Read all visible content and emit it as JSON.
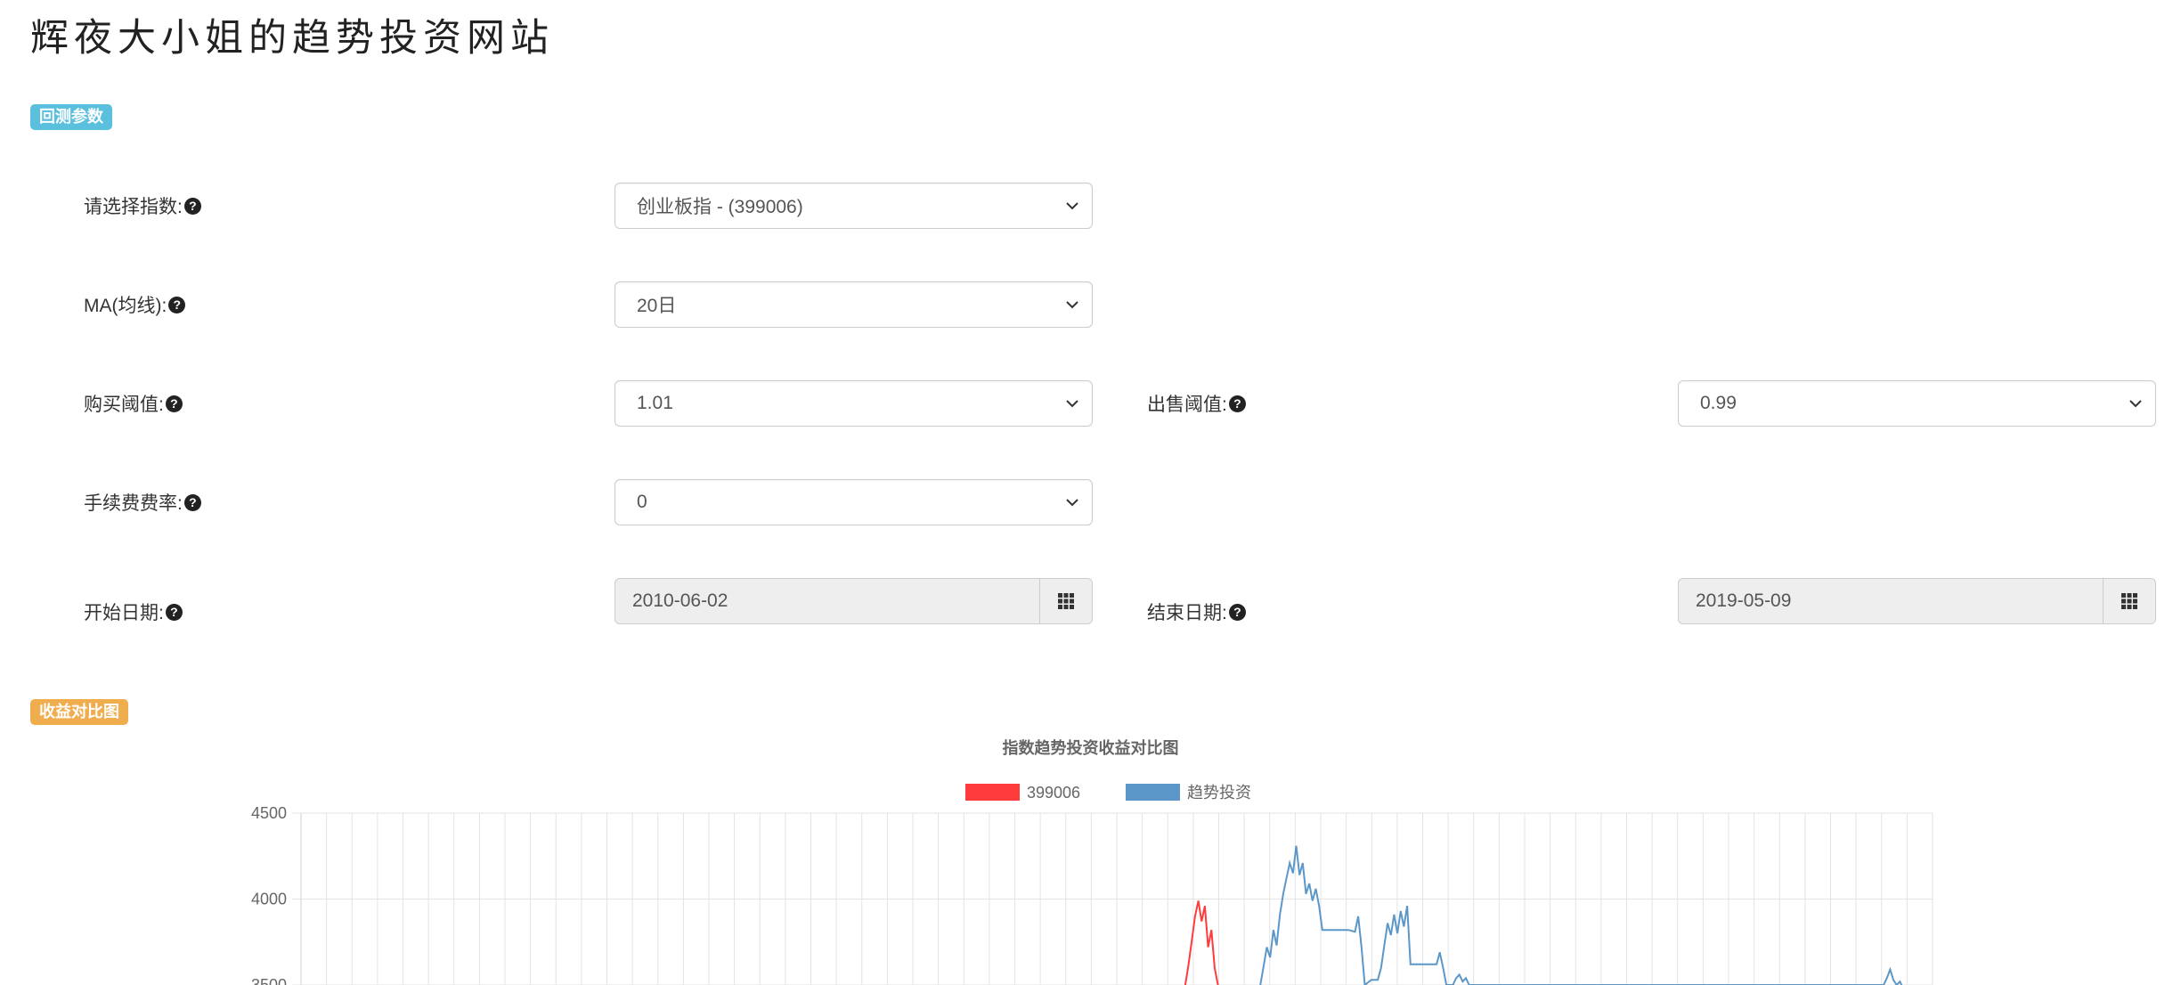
{
  "title": "辉夜大小姐的趋势投资网站",
  "params_badge": "回测参数",
  "compare_badge": "收益对比图",
  "form": {
    "index_label": "请选择指数:",
    "index_value": "创业板指 - (399006)",
    "ma_label": "MA(均线):",
    "ma_value": "20日",
    "buy_label": "购买阈值:",
    "buy_value": "1.01",
    "sell_label": "出售阈值:",
    "sell_value": "0.99",
    "fee_label": "手续费费率:",
    "fee_value": "0",
    "start_label": "开始日期:",
    "start_value": "2010-06-02",
    "end_label": "结束日期:",
    "end_value": "2019-05-09"
  },
  "colors": {
    "info": "#5bc0de",
    "warning": "#f0ad4e",
    "series_index": "#ff3b3b",
    "series_trend": "#5b97c9"
  },
  "icons": {
    "help": "question-circle-icon",
    "calendar": "calendar-grid-icon",
    "dropdown": "chevron-down-icon"
  },
  "chart_data": {
    "type": "line",
    "title": "指数趋势投资收益对比图",
    "legend_position": "top-center",
    "grid": true,
    "yticks": [
      3500,
      4000,
      4500
    ],
    "ylim": [
      3500,
      4500
    ],
    "series": [
      {
        "name": "399006",
        "color": "#ff3b3b",
        "values": [
          [
            0.542,
            3500
          ],
          [
            0.544,
            3620
          ],
          [
            0.546,
            3760
          ],
          [
            0.548,
            3900
          ],
          [
            0.55,
            3990
          ],
          [
            0.552,
            3870
          ],
          [
            0.554,
            3960
          ],
          [
            0.556,
            3720
          ],
          [
            0.558,
            3820
          ],
          [
            0.56,
            3600
          ],
          [
            0.562,
            3500
          ]
        ]
      },
      {
        "name": "趋势投资",
        "color": "#5b97c9",
        "values": [
          [
            0.588,
            3500
          ],
          [
            0.59,
            3610
          ],
          [
            0.592,
            3720
          ],
          [
            0.594,
            3660
          ],
          [
            0.596,
            3820
          ],
          [
            0.598,
            3730
          ],
          [
            0.6,
            3910
          ],
          [
            0.602,
            4030
          ],
          [
            0.604,
            4120
          ],
          [
            0.606,
            4210
          ],
          [
            0.608,
            4150
          ],
          [
            0.61,
            4310
          ],
          [
            0.612,
            4140
          ],
          [
            0.614,
            4210
          ],
          [
            0.616,
            4030
          ],
          [
            0.618,
            4090
          ],
          [
            0.62,
            3990
          ],
          [
            0.622,
            4060
          ],
          [
            0.624,
            3960
          ],
          [
            0.626,
            3820
          ],
          [
            0.634,
            3820
          ],
          [
            0.642,
            3820
          ],
          [
            0.646,
            3810
          ],
          [
            0.648,
            3900
          ],
          [
            0.65,
            3720
          ],
          [
            0.652,
            3500
          ],
          [
            0.656,
            3530
          ],
          [
            0.66,
            3530
          ],
          [
            0.662,
            3600
          ],
          [
            0.664,
            3730
          ],
          [
            0.666,
            3860
          ],
          [
            0.668,
            3790
          ],
          [
            0.67,
            3910
          ],
          [
            0.672,
            3800
          ],
          [
            0.674,
            3930
          ],
          [
            0.676,
            3840
          ],
          [
            0.678,
            3960
          ],
          [
            0.68,
            3620
          ],
          [
            0.69,
            3620
          ],
          [
            0.696,
            3620
          ],
          [
            0.698,
            3690
          ],
          [
            0.7,
            3600
          ],
          [
            0.702,
            3500
          ],
          [
            0.706,
            3500
          ],
          [
            0.708,
            3540
          ],
          [
            0.71,
            3560
          ],
          [
            0.712,
            3520
          ],
          [
            0.714,
            3540
          ],
          [
            0.716,
            3500
          ],
          [
            0.97,
            3500
          ],
          [
            0.972,
            3540
          ],
          [
            0.974,
            3590
          ],
          [
            0.976,
            3530
          ],
          [
            0.978,
            3500
          ],
          [
            0.98,
            3520
          ],
          [
            0.982,
            3480
          ]
        ]
      }
    ]
  }
}
